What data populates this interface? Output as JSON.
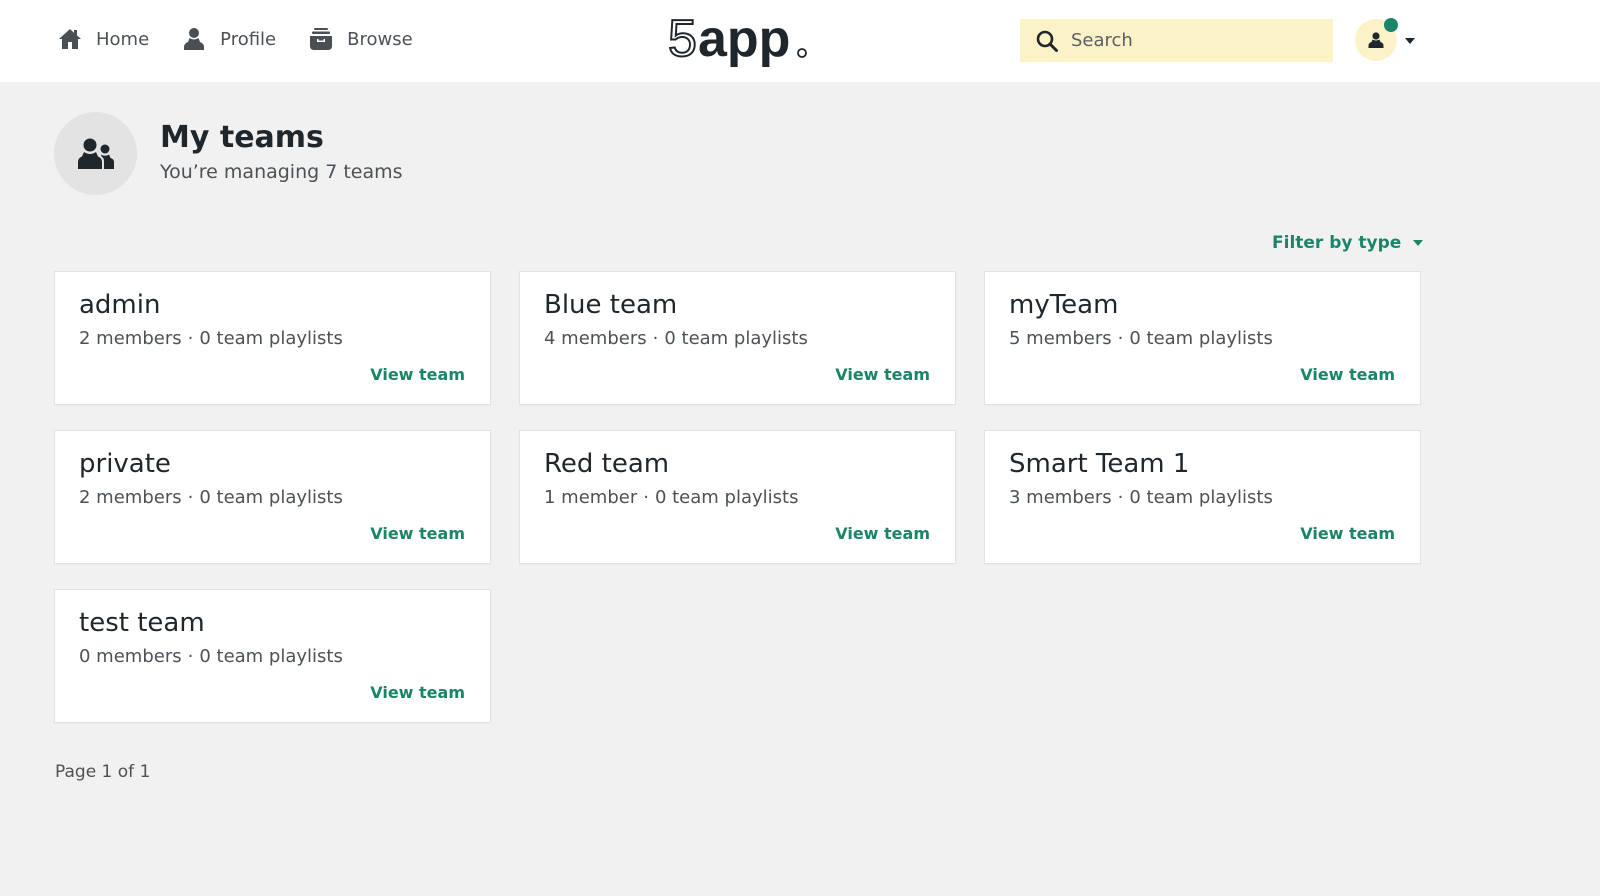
{
  "nav": {
    "items": [
      {
        "label": "Home",
        "icon": "home-icon"
      },
      {
        "label": "Profile",
        "icon": "user-icon"
      },
      {
        "label": "Browse",
        "icon": "archive-icon"
      }
    ]
  },
  "logo": {
    "text": "5app",
    "alt": "5app logo"
  },
  "search": {
    "placeholder": "Search",
    "value": ""
  },
  "user_menu": {
    "has_notification": true,
    "notification_color": "#1a8568"
  },
  "header": {
    "title": "My teams",
    "subtitle": "You’re managing 7 teams"
  },
  "filter": {
    "label": "Filter by type"
  },
  "teams": [
    {
      "name": "admin",
      "members": "2 members",
      "playlists": "0 team playlists",
      "link": "View team"
    },
    {
      "name": "Blue team",
      "members": "4 members",
      "playlists": "0 team playlists",
      "link": "View team"
    },
    {
      "name": "myTeam",
      "members": "5 members",
      "playlists": "0 team playlists",
      "link": "View team"
    },
    {
      "name": "private",
      "members": "2 members",
      "playlists": "0 team playlists",
      "link": "View team"
    },
    {
      "name": "Red team",
      "members": "1 member",
      "playlists": "0 team playlists",
      "link": "View team"
    },
    {
      "name": "Smart Team 1",
      "members": "3 members",
      "playlists": "0 team playlists",
      "link": "View team"
    },
    {
      "name": "test team",
      "members": "0 members",
      "playlists": "0 team playlists",
      "link": "View team"
    }
  ],
  "separator": "·",
  "pagination": {
    "text": "Page 1 of 1"
  },
  "colors": {
    "accent": "#1a8568",
    "search_bg": "#fbf2c8",
    "page_bg": "#f1f1f1",
    "text": "#1f262c"
  }
}
